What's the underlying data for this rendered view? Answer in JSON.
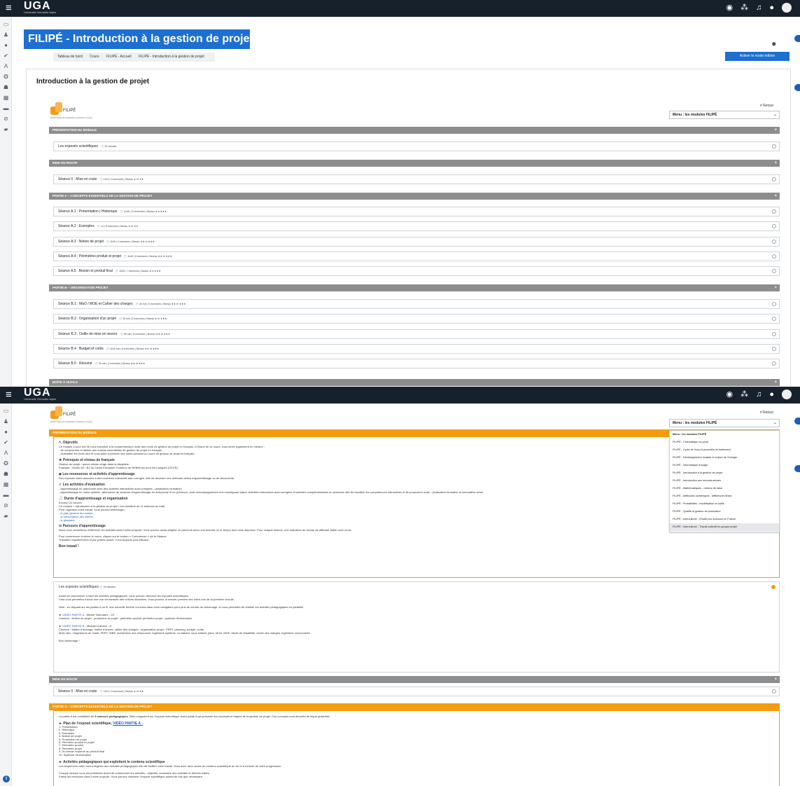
{
  "topbar": {
    "menu_glyph": "≡",
    "logo": "UGA",
    "logo_sub": "Université Grenoble Alpes",
    "icons": [
      "globe-icon",
      "network-icon",
      "bell-icon",
      "chat-icon",
      "avatar"
    ]
  },
  "leftrail_icons": [
    "folder-icon",
    "users-icon",
    "dot-icon",
    "check-icon",
    "letter-icon",
    "badge-icon",
    "graduation-icon",
    "calendar-icon",
    "box-icon",
    "clip-icon",
    "folder2-icon"
  ],
  "course": {
    "banner_title": "FILIPÉ - Introduction à la gestion de projet",
    "breadcrumb": [
      "Tableau de bord",
      "Cours",
      "FILIPÉ - Accueil",
      "FILIPÉ - Introduction à la gestion de projet"
    ],
    "edit_button": "Activer le mode édition",
    "page_title": "Introduction à la gestion de projet"
  },
  "filipe": {
    "logo_text": "FILIPÉ",
    "tagline": "Filières Ingénieurs Préparatoire aux Etudes en France",
    "retour": "# Retour",
    "menu_label": "Menu : les modules FILIPÉ"
  },
  "top_outline": {
    "sections": [
      {
        "label": "PRÉSENTATION DU MODULE",
        "rows": [
          {
            "title": "Les exposés scientifiques",
            "meta": "🕘 23 minutes"
          }
        ]
      },
      {
        "label": "MISE EN ROUTE",
        "rows": [
          {
            "title": "Séance 0 : Mise en route",
            "meta": "🕘 1h10 | 9 exercices | Niveau ★ et ★★"
          }
        ]
      },
      {
        "label": "PARTIE A – CONCEPTS ESSENTIELS DE LA GESTION DE PROJET",
        "rows": [
          {
            "title": "Séance A.1 : Présentation | Historique",
            "meta": "🕘 1h35 | 13 exercices | Niveau ★ à ★★★"
          },
          {
            "title": "Séance A.2 : Exemples",
            "meta": "🕘 1h | 8 exercices | Niveau ★ et ★★"
          },
          {
            "title": "Séance A.3 : Notion de projet",
            "meta": "🕘 1h05 | 9 exercices | Niveau ★★ et ★★★"
          },
          {
            "title": "Séance A.4 : Périmètres produit et projet",
            "meta": "🕘 1h40 | 8 exercices | Niveau ★★ et ★★★"
          },
          {
            "title": "Séance A.5 : Besoin et produit final",
            "meta": "🕘 1h05 | 7 exercices | Niveau ★ à ★★★"
          }
        ]
      },
      {
        "label": "PARTIE B – ORGANISATION PROJET",
        "rows": [
          {
            "title": "Séance B.1 : MàO / MOE et Cahier des charges",
            "meta": "🕘 40 min | 5 exercices | Niveau ★★ et ★★★"
          },
          {
            "title": "Séance B.2 : Organisation d'un projet",
            "meta": "🕘 35 min | 5 exercices | Niveau ★ et ★★★"
          },
          {
            "title": "Séance B.3 : Outils de mise en œuvre",
            "meta": "🕘 55 min | 8 exercices | Niveau ★★ et ★★★"
          },
          {
            "title": "Séance B.4 : Budget et coûts",
            "meta": "🕘 1h15 min | 8 exercices | Niveau ★★ et ★★★"
          },
          {
            "title": "Séance B.5 : Résumé",
            "meta": "🕘 30 min | 3 exercices | Niveau ★★ et ★★★"
          }
        ]
      },
      {
        "label": "BOÎTE À OUTILS",
        "rows": []
      }
    ]
  },
  "menu_options": [
    "Menu : les modules FILIPÉ",
    "FILIPÉ - Cinématique du point",
    "FILIPÉ - Cycle de l'eau et procédés de traitement",
    "FILIPÉ - Développement durable et enjeux de l'énergie",
    "FILIPÉ - Informatique d'usage",
    "FILIPÉ - Introduction à la gestion de projet",
    "FILIPÉ - Introduction aux microstructures",
    "FILIPÉ - Mathématiques - notions de base",
    "FILIPÉ - Méthodes numériques - différences finies",
    "FILIPÉ - Probabilités - modélisation et outils",
    "FILIPÉ - Qualité et gestion de production",
    "FILIPÉ - Interculturel - Étudier les sciences en France",
    "FILIPÉ - Interculturel - Travail collectif en groupe projet"
  ],
  "presentation": {
    "section_label": "PRÉSENTATION DU MODULE",
    "objectifs_h": "↖ Objectifs",
    "objectifs": [
      "Ce module a pour but de vous entraîner à la compréhension orale des cours de gestion de projet en français. A l'issue de ce cours, vous serez également en mesure :",
      "- de comprendre et utiliser des notions essentielles de gestion de projet en français.",
      "- d'identifier les mots clés et vous aider à prendre des notes pendant un cours de gestion de projet et français."
    ],
    "prereq_h": "★ Prérequis et niveau de français",
    "prereq": [
      "Gestion de projet : aucun niveau exigé dans la discipline.",
      "Français : niveau A2 / B1 du Cadre Européen Commun de Référence pour les Langues (CECR)."
    ],
    "ressources_h": "◈ Les ressources et activités d'apprentissage",
    "ressources": [
      "Des exposés vidéo associés à des exercices interactifs auto-corrigés. Afin de favoriser une méthode active d'apprentissage ou de découverte."
    ],
    "eval_h": "✓ Les activités d'évaluation",
    "eval": [
      "- Apprentissage en autonomie avec des activités interactives auto-corrigées - (évaluation formative)",
      "- Apprentissage en mode hybride : alternance de séances d'apprentissage en autonomie et en présence, avec accompagnement d'un enseignant-tuteur. Activités interactives auto-corrigées et activités complémentaires en présence afin de travailler les compétences interactives et de production orale - (évaluation formative et sommative selon"
    ],
    "duree_h": "🕘 Durée d'apprentissage et organisation",
    "duree": [
      "Environ 20 heures",
      "Ce module « Introduction à la gestion de projet » est constitué de 11 séances au total.",
      "Pour organiser votre travail, vous pouvez télécharger :"
    ],
    "links": [
      "le plan général du module",
      "la transcription des vidéos",
      "le glossaire"
    ],
    "parcours_h": "⊙ Parcours d'apprentissage",
    "parcours": [
      "Nous vous conseillons d'effectuer les activités dans l'ordre proposé. Vous pouvez aussi adapter ce parcours selon vos besoins ou le temps dont vous disposez. Pour chaque séance, une indication de niveau de difficulté faible votre choix.",
      "Pour commencer à suivre le cours, cliquez sur le bouton « Commencer » de la Séance.",
      "Travaillez régulièrement et par petites doses. C'est toujours plus efficace."
    ],
    "bon": "Bon travail !"
  },
  "exposes": {
    "title": "Les exposés scientifiques",
    "meta": "🕘 23 minutes",
    "lines": [
      "Avant de commencer à faire les activités pédagogiques, vous pouvez visionner les exposés scientifiques.",
      "Cela vous permettra d'avoir une vue d'ensemble des notions abordées. Vous pouvez, si besoin, prendre des notes lors de la première écoute.",
      "Note : en cliquant sur les parties A ou B, une nouvelle fenêtre s'ouvrira dans votre navigateur pour plus de confort de visionnage, et vous permettra de réaliser les activités pédagogiques en parallèle."
    ],
    "videoA_link": "VIDÉO PARTIE A",
    "videoA_author": " - Michel Tollenaere - 15'",
    "videoA_desc": "Contenu : Notion de projet ; production et projet ; périmètre produit, périmètre projet ; système d'information.",
    "videoB_link": "VIDÉO PARTIE B",
    "videoB_author": " - Mickaël Gardoni - 8'",
    "videoB_desc1": "Contenu : Maître d'ouvrage, maître d'œuvre, cahier des charges ; organisation projet ; PERT, planning, budget, coûts.",
    "videoB_desc2": "Mots clés : Diagramme de Gantt, PERT, WBS, subdivision des ressources, ingénierie système, co-traitant, sous-traitant, jalon, MOA, MOE, étude de faisabilité, cahier des charges, ingénierie concourante.",
    "bye": "Bon visionnage !"
  },
  "mise2": {
    "label": "MISE EN ROUTE",
    "row_title": "Séance 0 : Mise en route",
    "row_meta": "🕘 1h10 | 9 exercices | Niveau ★ et ★★"
  },
  "partieA2": {
    "label": "PARTIE A – CONCEPTS ESSENTIELS DE LA GESTION DE PROJET",
    "intro_pre": "La partie A est constituée de ",
    "intro_bold": "5 séances pédagogiques",
    "intro_post": ". Elles s'appuient sur l'exposé scientifique vidéo partie A qui présente les concepts et étapes de la gestion de projet. Ces concepts sont abordés de façon graduelle.",
    "plan_h": "► Plan de l'exposé scientifique,",
    "plan_link": "VIDÉO PARTIE A :",
    "plan": [
      "1. Présentation",
      "2. Historique",
      "3. Exemples",
      "4. Notion de projet",
      "5. Production de projet",
      "6. Périmètre produit et projet",
      "7. Périmètre produit",
      "8. Périmètre projet",
      "9. Du besoin exprimé au produit final",
      "10. Système d'information"
    ],
    "act_h": "► Activités pédagogiques qui exploitent le contenu scientifique",
    "act": "Les séquences vidéo sont intégrées aux activités pédagogiques afin de faciliter votre travail. Vous avez donc accès au contenu scientifique au fur et à mesure de votre progression.",
    "tail1": "Chaque séance vous est présentée avant de commencer les activités : objectifs, sommaire des activités et thèmes traités.",
    "tail2": "Faites les exercices dans l'ordre proposé. Vous pouvez visionner l'exposé scientifique autant de fois que nécessaire."
  },
  "colors": {
    "banner": "#1d6fd0",
    "topbar": "#17212b",
    "section_grey": "#8d8d8d",
    "section_orange": "#f39c12",
    "link": "#1d5fb8"
  }
}
